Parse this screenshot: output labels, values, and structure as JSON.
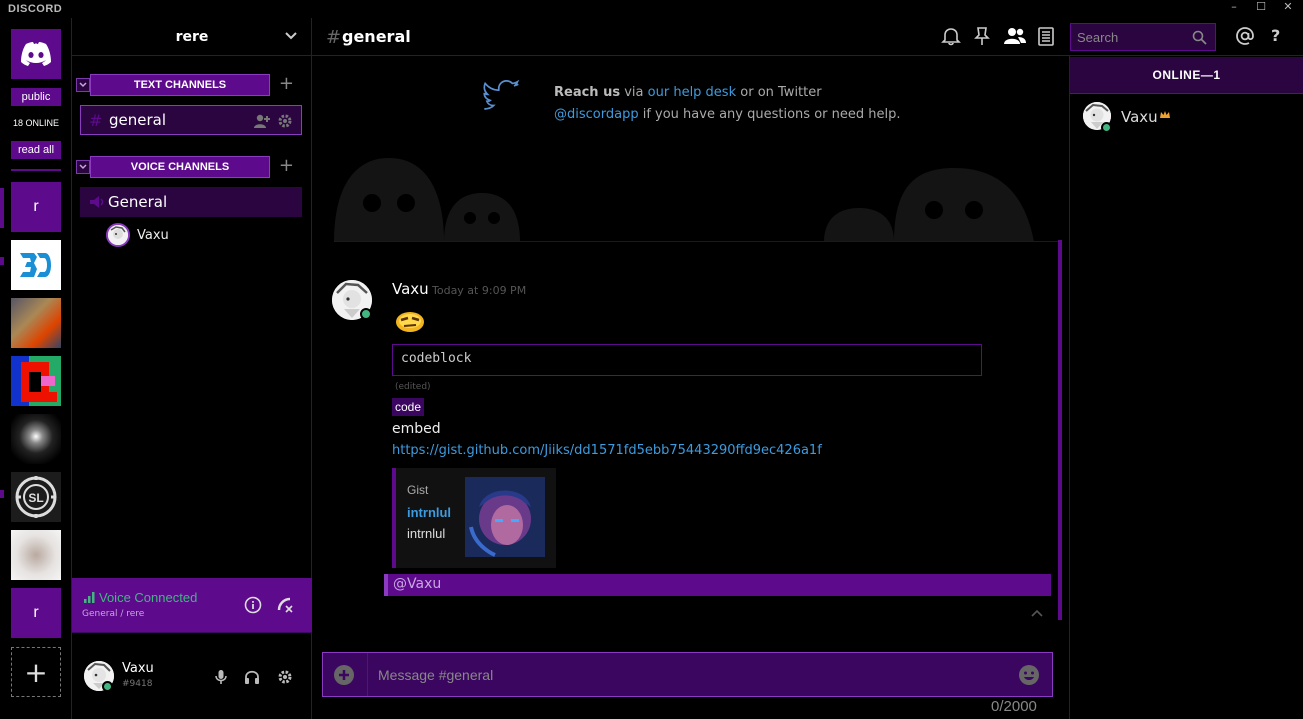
{
  "app": {
    "brand": "DISCORD"
  },
  "window": {
    "minimize": "–",
    "maximize": "☐",
    "close": "✕"
  },
  "servers": {
    "public_label": "public",
    "online_label": "18 ONLINE",
    "read_all_label": "read all",
    "items": [
      {
        "name": "r",
        "letter": "r"
      },
      {
        "name": "3D"
      },
      {
        "name": "server-avatar-2"
      },
      {
        "name": "server-avatar-3"
      },
      {
        "name": "server-avatar-4"
      },
      {
        "name": "SL"
      },
      {
        "name": "server-avatar-6"
      },
      {
        "name": "r",
        "letter": "r"
      }
    ],
    "add_label": "+"
  },
  "guild": {
    "name": "rere",
    "text_category": "TEXT CHANNELS",
    "voice_category": "VOICE CHANNELS",
    "text_channel": "general",
    "voice_channel": "General",
    "voice_user": "Vaxu"
  },
  "voice_status": {
    "status": "Voice Connected",
    "location": "General / rere"
  },
  "user": {
    "name": "Vaxu",
    "tag": "#9418"
  },
  "header": {
    "hash": "#",
    "channel": "general",
    "search_placeholder": "Search"
  },
  "welcome": {
    "bold": "Reach us",
    "via": "via",
    "help_desk": "our help desk",
    "or_twitter": "or on Twitter",
    "handle": "@discordapp",
    "tail": "if you have any questions or need help."
  },
  "message": {
    "author": "Vaxu",
    "timestamp": "Today at 9:09 PM",
    "codeblock": "codeblock",
    "edited": "(edited)",
    "inline_code": "code",
    "text": "embed",
    "url": "https://gist.github.com/Jiiks/dd1571fd5ebb75443290ffd9ec426a1f",
    "embed": {
      "provider": "Gist",
      "title": "intrnlul",
      "description": "intrnlul"
    }
  },
  "mention": "@Vaxu",
  "composer": {
    "placeholder": "Message #general",
    "counter": "0/2000"
  },
  "members": {
    "group": "ONLINE—1",
    "list": [
      {
        "name": "Vaxu"
      }
    ]
  },
  "colors": {
    "accent": "#5d0a8c",
    "accent_dark": "#2a0540",
    "online": "#43b581",
    "link": "#3d9bdf"
  }
}
